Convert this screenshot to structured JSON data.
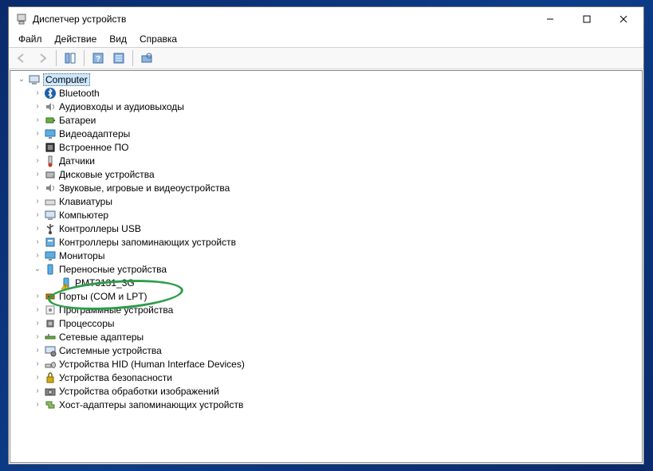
{
  "window": {
    "title": "Диспетчер устройств"
  },
  "menubar": {
    "items": [
      "Файл",
      "Действие",
      "Вид",
      "Справка"
    ]
  },
  "tree": {
    "root": "Computer",
    "categories": [
      {
        "label": "Bluetooth",
        "children": []
      },
      {
        "label": "Аудиовходы и аудиовыходы",
        "children": []
      },
      {
        "label": "Батареи",
        "children": []
      },
      {
        "label": "Видеоадаптеры",
        "children": []
      },
      {
        "label": "Встроенное ПО",
        "children": []
      },
      {
        "label": "Датчики",
        "children": []
      },
      {
        "label": "Дисковые устройства",
        "children": []
      },
      {
        "label": "Звуковые, игровые и видеоустройства",
        "children": []
      },
      {
        "label": "Клавиатуры",
        "children": []
      },
      {
        "label": "Компьютер",
        "children": []
      },
      {
        "label": "Контроллеры USB",
        "children": []
      },
      {
        "label": "Контроллеры запоминающих устройств",
        "children": []
      },
      {
        "label": "Мониторы",
        "children": []
      },
      {
        "label": "Переносные устройства",
        "expanded": true,
        "children": [
          {
            "label": "PMT3131_3G",
            "warn": true
          }
        ]
      },
      {
        "label": "Порты (COM и LPT)",
        "children": []
      },
      {
        "label": "Программные устройства",
        "children": []
      },
      {
        "label": "Процессоры",
        "children": []
      },
      {
        "label": "Сетевые адаптеры",
        "children": []
      },
      {
        "label": "Системные устройства",
        "children": []
      },
      {
        "label": "Устройства HID (Human Interface Devices)",
        "children": []
      },
      {
        "label": "Устройства безопасности",
        "children": []
      },
      {
        "label": "Устройства обработки изображений",
        "children": []
      },
      {
        "label": "Хост-адаптеры запоминающих устройств",
        "children": []
      }
    ]
  }
}
